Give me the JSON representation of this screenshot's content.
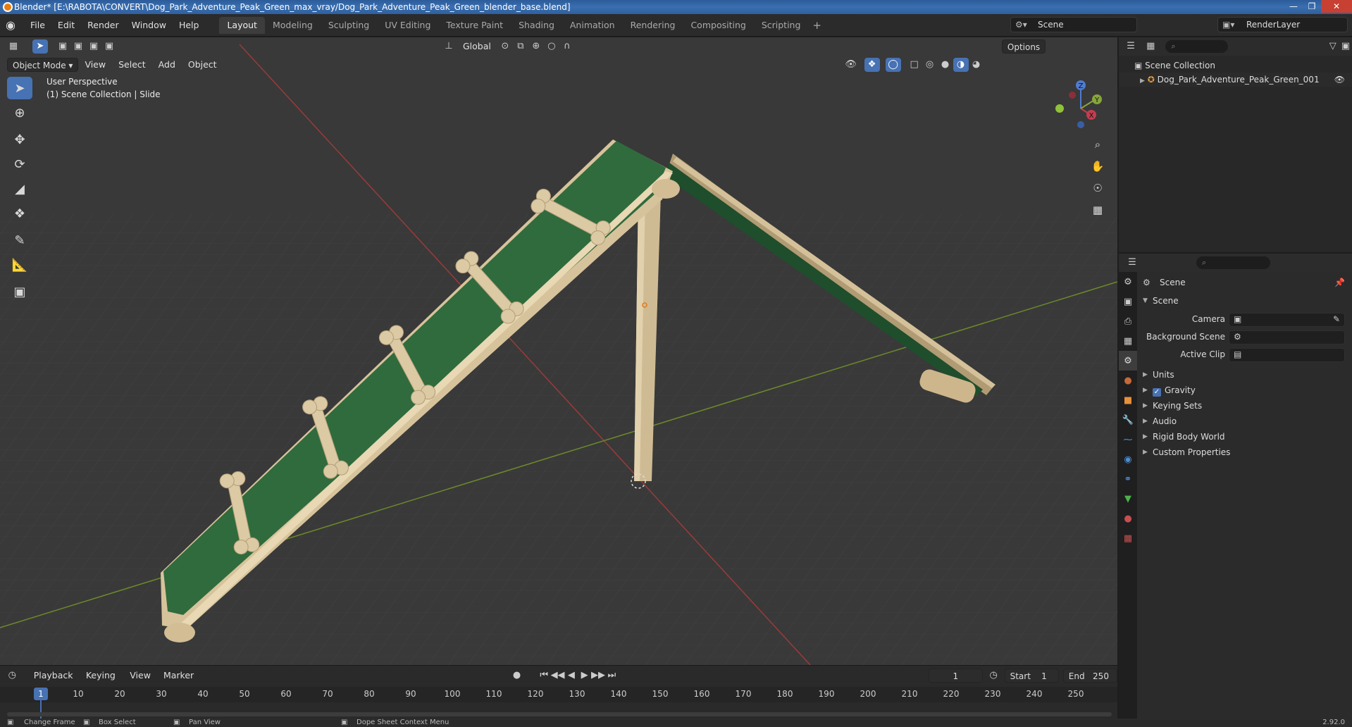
{
  "window": {
    "title": "Blender* [E:\\RABOTA\\CONVERT\\Dog_Park_Adventure_Peak_Green_max_vray/Dog_Park_Adventure_Peak_Green_blender_base.blend]"
  },
  "menu": [
    "File",
    "Edit",
    "Render",
    "Window",
    "Help"
  ],
  "workspaces": [
    {
      "label": "Layout",
      "active": true
    },
    {
      "label": "Modeling"
    },
    {
      "label": "Sculpting"
    },
    {
      "label": "UV Editing"
    },
    {
      "label": "Texture Paint"
    },
    {
      "label": "Shading"
    },
    {
      "label": "Animation"
    },
    {
      "label": "Rendering"
    },
    {
      "label": "Compositing"
    },
    {
      "label": "Scripting"
    }
  ],
  "scene_selector": "Scene",
  "layer_selector": "RenderLayer",
  "viewport": {
    "orientation": "Global",
    "options_label": "Options",
    "mode": "Object Mode",
    "menus": [
      "View",
      "Select",
      "Add",
      "Object"
    ],
    "info_line1": "User Perspective",
    "info_line2": "(1) Scene Collection | Slide",
    "gizmo": {
      "x": "X",
      "y": "Y",
      "z": "Z"
    }
  },
  "outliner": {
    "root": "Scene Collection",
    "items": [
      "Dog_Park_Adventure_Peak_Green_001"
    ]
  },
  "properties": {
    "title": "Scene",
    "section": "Scene",
    "fields": [
      {
        "label": "Camera",
        "value": ""
      },
      {
        "label": "Background Scene",
        "value": ""
      },
      {
        "label": "Active Clip",
        "value": ""
      }
    ],
    "subsections": [
      {
        "label": "Units",
        "checkbox": false
      },
      {
        "label": "Gravity",
        "checkbox": true
      },
      {
        "label": "Keying Sets",
        "checkbox": false
      },
      {
        "label": "Audio",
        "checkbox": false
      },
      {
        "label": "Rigid Body World",
        "checkbox": false
      },
      {
        "label": "Custom Properties",
        "checkbox": false
      }
    ]
  },
  "timeline": {
    "menus": [
      "Playback",
      "Keying",
      "View",
      "Marker"
    ],
    "current_frame": "1",
    "start_label": "Start",
    "start": "1",
    "end_label": "End",
    "end": "250",
    "ticks": [
      "10",
      "20",
      "30",
      "40",
      "50",
      "60",
      "70",
      "80",
      "90",
      "100",
      "110",
      "120",
      "130",
      "140",
      "150",
      "160",
      "170",
      "180",
      "190",
      "200",
      "210",
      "220",
      "230",
      "240",
      "250"
    ],
    "cursor_label": "1"
  },
  "statusbar": {
    "items": [
      "Change Frame",
      "Box Select",
      "Pan View",
      "Dope Sheet Context Menu"
    ],
    "version": "2.92.0"
  }
}
